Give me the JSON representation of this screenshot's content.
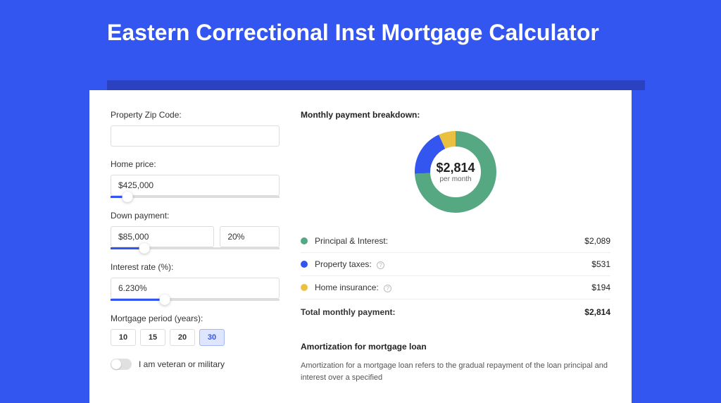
{
  "page_title": "Eastern Correctional Inst Mortgage Calculator",
  "form": {
    "zip": {
      "label": "Property Zip Code:",
      "value": ""
    },
    "home_price": {
      "label": "Home price:",
      "value": "$425,000",
      "slider_percent": 10
    },
    "down_payment": {
      "label": "Down payment:",
      "amount": "$85,000",
      "percent": "20%",
      "slider_percent": 20
    },
    "interest_rate": {
      "label": "Interest rate (%):",
      "value": "6.230%",
      "slider_percent": 32
    },
    "period": {
      "label": "Mortgage period (years):",
      "options": [
        "10",
        "15",
        "20",
        "30"
      ],
      "active": "30"
    },
    "veteran": {
      "label": "I am veteran or military",
      "on": false
    }
  },
  "breakdown": {
    "title": "Monthly payment breakdown:",
    "center_amount": "$2,814",
    "center_sub": "per month",
    "rows": [
      {
        "color": "green",
        "label": "Principal & Interest:",
        "value": "$2,089",
        "info": false
      },
      {
        "color": "blue",
        "label": "Property taxes:",
        "value": "$531",
        "info": true
      },
      {
        "color": "yellow",
        "label": "Home insurance:",
        "value": "$194",
        "info": true
      }
    ],
    "total_label": "Total monthly payment:",
    "total_value": "$2,814"
  },
  "amortization": {
    "title": "Amortization for mortgage loan",
    "text": "Amortization for a mortgage loan refers to the gradual repayment of the loan principal and interest over a specified"
  },
  "chart_data": {
    "type": "pie",
    "title": "Monthly payment breakdown",
    "series": [
      {
        "name": "Principal & Interest",
        "value": 2089,
        "color": "#55a882"
      },
      {
        "name": "Property taxes",
        "value": 531,
        "color": "#3355f0"
      },
      {
        "name": "Home insurance",
        "value": 194,
        "color": "#eac040"
      }
    ],
    "total": 2814
  },
  "colors": {
    "primary": "#3355f0",
    "green": "#55a882",
    "yellow": "#eac040"
  }
}
